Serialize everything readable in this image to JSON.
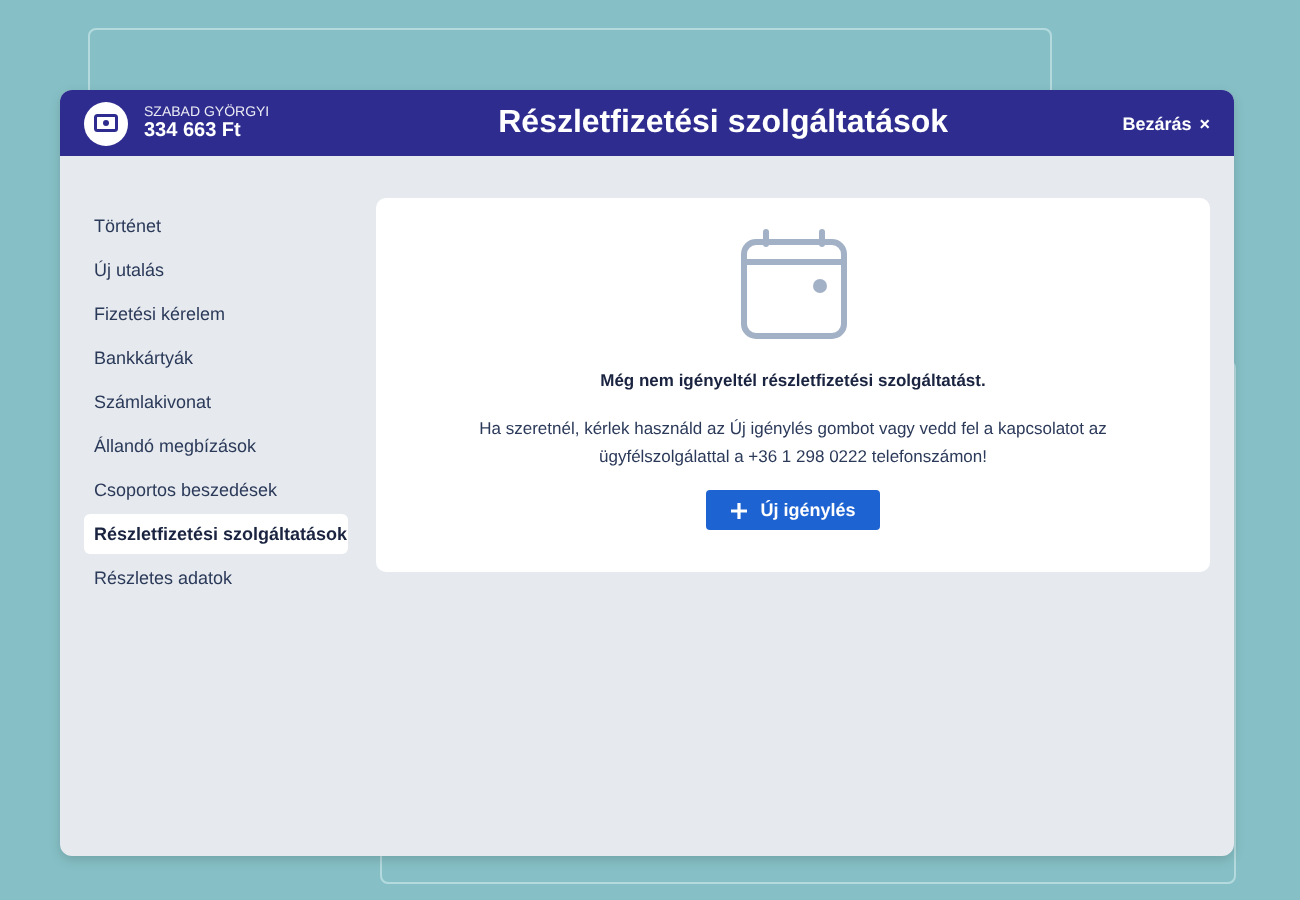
{
  "header": {
    "account_name": "SZABAD GYÖRGYI",
    "balance": "334 663 Ft",
    "title": "Részletfizetési szolgáltatások",
    "close_label": "Bezárás",
    "close_glyph": "×"
  },
  "sidebar": {
    "items": [
      {
        "label": "Történet",
        "selected": false
      },
      {
        "label": "Új utalás",
        "selected": false
      },
      {
        "label": "Fizetési kérelem",
        "selected": false
      },
      {
        "label": "Bankkártyák",
        "selected": false
      },
      {
        "label": "Számlakivonat",
        "selected": false
      },
      {
        "label": "Állandó megbízások",
        "selected": false
      },
      {
        "label": "Csoportos beszedések",
        "selected": false
      },
      {
        "label": "Részletfizetési szolgáltatások",
        "selected": true
      },
      {
        "label": "Részletes adatok",
        "selected": false
      }
    ]
  },
  "empty_state": {
    "heading": "Még nem igényeltél részletfizetési szolgáltatást.",
    "message": "Ha szeretnél, kérlek használd az Új igénylés gombot vagy vedd fel a kapcsolatot az ügyfélszolgálattal a +36 1 298 0222 telefonszámon!",
    "button": "Új igénylés"
  }
}
